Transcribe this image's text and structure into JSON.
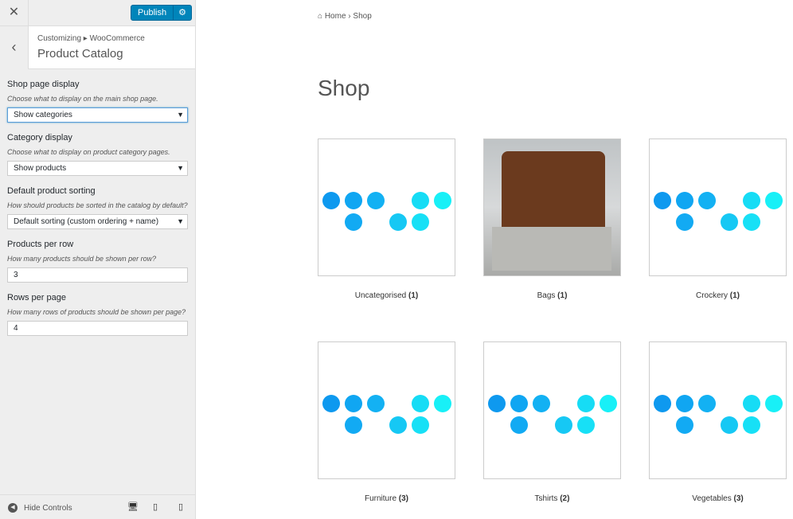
{
  "sidebar": {
    "close_icon": "close-icon",
    "publish": "Publish",
    "breadcrumb": "Customizing ▸ WooCommerce",
    "title": "Product Catalog",
    "settings": [
      {
        "label": "Shop page display",
        "desc": "Choose what to display on the main shop page.",
        "type": "select",
        "value": "Show categories"
      },
      {
        "label": "Category display",
        "desc": "Choose what to display on product category pages.",
        "type": "select",
        "value": "Show products"
      },
      {
        "label": "Default product sorting",
        "desc": "How should products be sorted in the catalog by default?",
        "type": "select",
        "value": "Default sorting (custom ordering + name)"
      },
      {
        "label": "Products per row",
        "desc": "How many products should be shown per row?",
        "type": "input",
        "value": "3"
      },
      {
        "label": "Rows per page",
        "desc": "How many rows of products should be shown per page?",
        "type": "input",
        "value": "4"
      }
    ],
    "hide_controls": "Hide Controls"
  },
  "main": {
    "breadcrumb": {
      "home": "Home",
      "current": "Shop"
    },
    "title": "Shop",
    "categories": [
      {
        "name": "Uncategorised",
        "count": "(1)",
        "image": "placeholder"
      },
      {
        "name": "Bags",
        "count": "(1)",
        "image": "leather-bag-photo"
      },
      {
        "name": "Crockery",
        "count": "(1)",
        "image": "placeholder"
      },
      {
        "name": "Furniture",
        "count": "(3)",
        "image": "placeholder"
      },
      {
        "name": "Tshirts",
        "count": "(2)",
        "image": "placeholder"
      },
      {
        "name": "Vegetables",
        "count": "(3)",
        "image": "placeholder"
      }
    ]
  },
  "colors": {
    "accent": "#0085ba"
  }
}
